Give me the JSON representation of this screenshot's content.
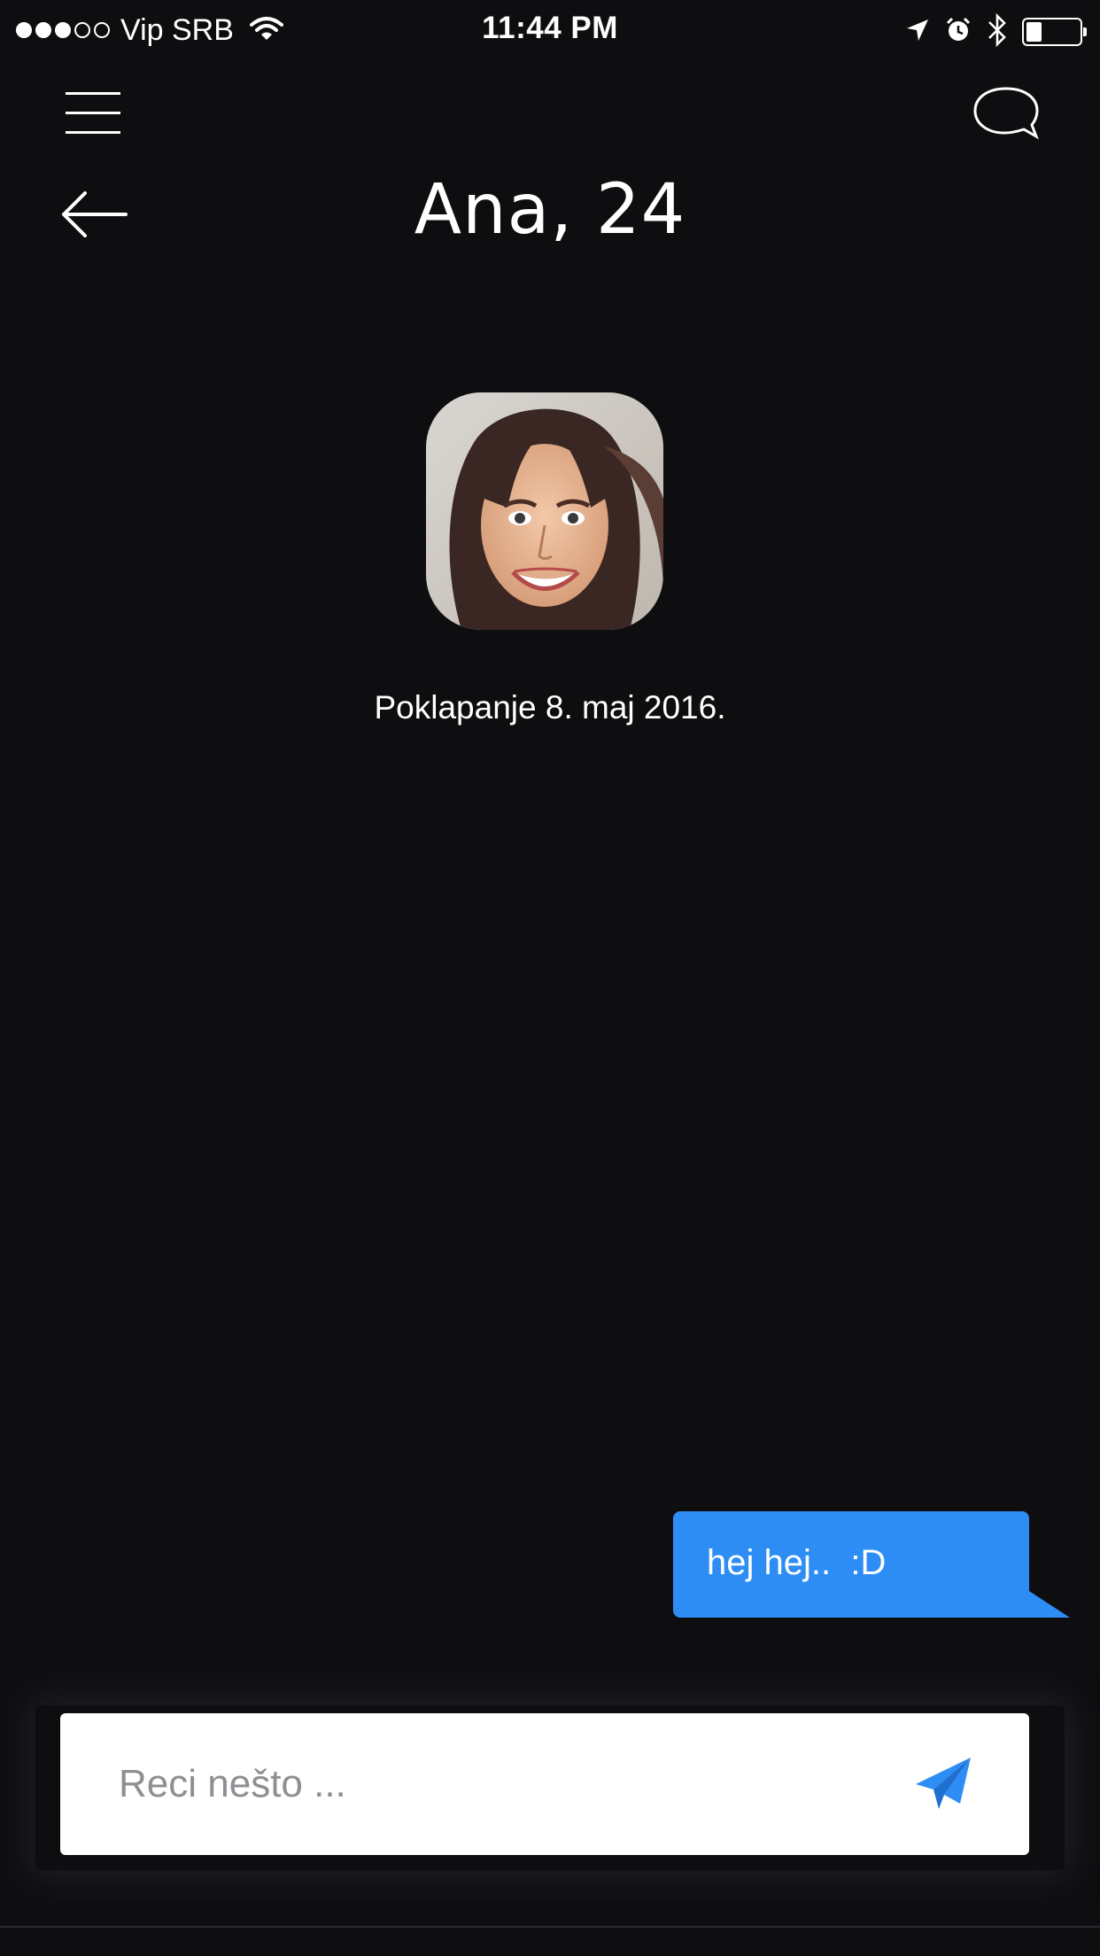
{
  "status_bar": {
    "signal_bars": [
      true,
      true,
      true,
      false,
      false
    ],
    "carrier": "Vip SRB",
    "time": "11:44 PM",
    "battery_level": 0.3
  },
  "header": {
    "title": "Ana, 24"
  },
  "match": {
    "date_text": "Poklapanje 8. maj 2016."
  },
  "messages": [
    {
      "direction": "outgoing",
      "text": "hej hej..  :D"
    }
  ],
  "composer": {
    "placeholder": "Reci nešto ...",
    "value": ""
  },
  "colors": {
    "background": "#0e0e11",
    "bubble": "#2d8df4",
    "send_icon": "#2d8df4"
  },
  "icons": {
    "menu": "hamburger-menu-icon",
    "chat": "chat-bubble-icon",
    "back": "arrow-left-icon",
    "send": "paper-plane-icon",
    "wifi": "wifi-icon",
    "location": "location-arrow-icon",
    "alarm": "alarm-clock-icon",
    "bluetooth": "bluetooth-icon",
    "battery": "battery-icon"
  }
}
